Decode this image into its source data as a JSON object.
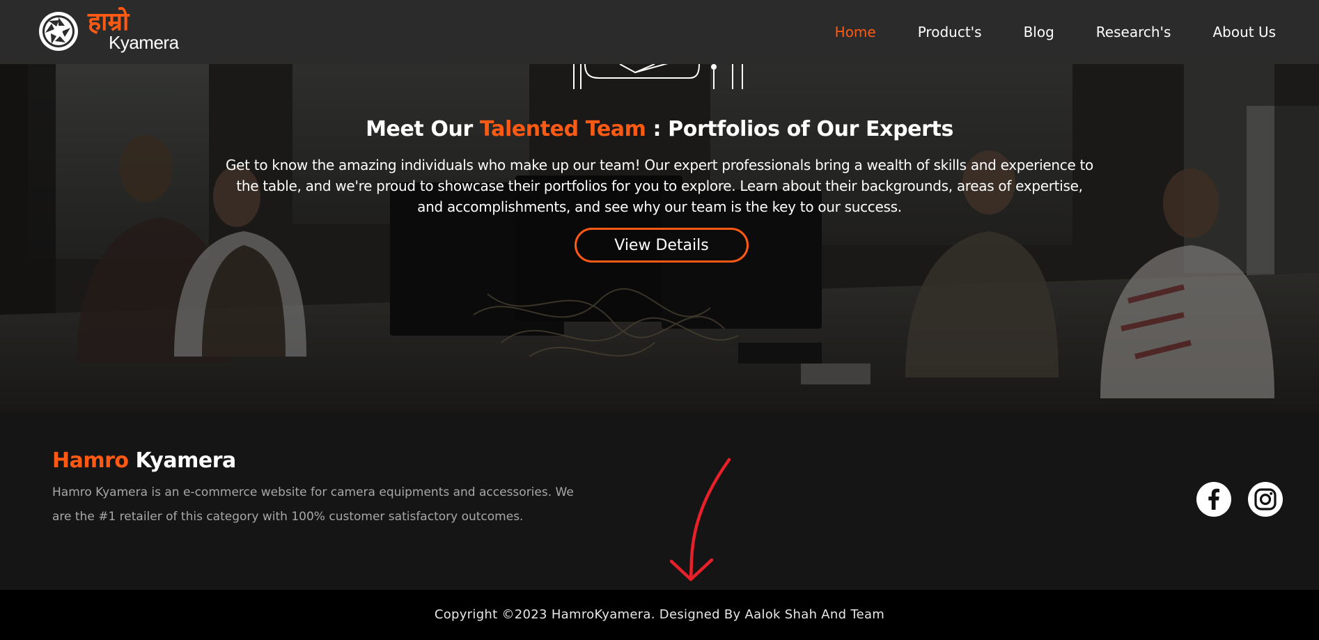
{
  "colors": {
    "accent": "#ff5a14",
    "nav_bg": "#2b2b2b",
    "footer_bg": "#151515",
    "copyright_bg": "#000000"
  },
  "brand": {
    "logo_devanagari": "हाम्रो",
    "logo_text": "Kyamera"
  },
  "nav": {
    "items": [
      {
        "label": "Home",
        "active": true
      },
      {
        "label": "Product's",
        "active": false
      },
      {
        "label": "Blog",
        "active": false
      },
      {
        "label": "Research's",
        "active": false
      },
      {
        "label": "About Us",
        "active": false
      }
    ]
  },
  "hero": {
    "title_prefix": "Meet Our ",
    "title_accent": "Talented Team",
    "title_suffix": " : Portfolios of Our Experts",
    "description": "Get to know the amazing individuals who make up our team! Our expert professionals bring a wealth of skills and experience to the table, and we're proud to showcase their portfolios for you to explore. Learn about their backgrounds, areas of expertise, and accomplishments, and see why our team is the key to our success.",
    "button_label": "View Details"
  },
  "footer": {
    "brand_accent": "Hamro",
    "brand_rest": " Kyamera",
    "description": "Hamro Kyamera is an e-commerce website for camera equipments and accessories. We are the #1 retailer of this category with 100% customer satisfactory outcomes.",
    "social": [
      {
        "icon": "facebook-icon"
      },
      {
        "icon": "instagram-icon"
      }
    ]
  },
  "copyright": {
    "text": "Copyright ©2023 HamroKyamera. Designed By Aalok Shah And Team"
  }
}
